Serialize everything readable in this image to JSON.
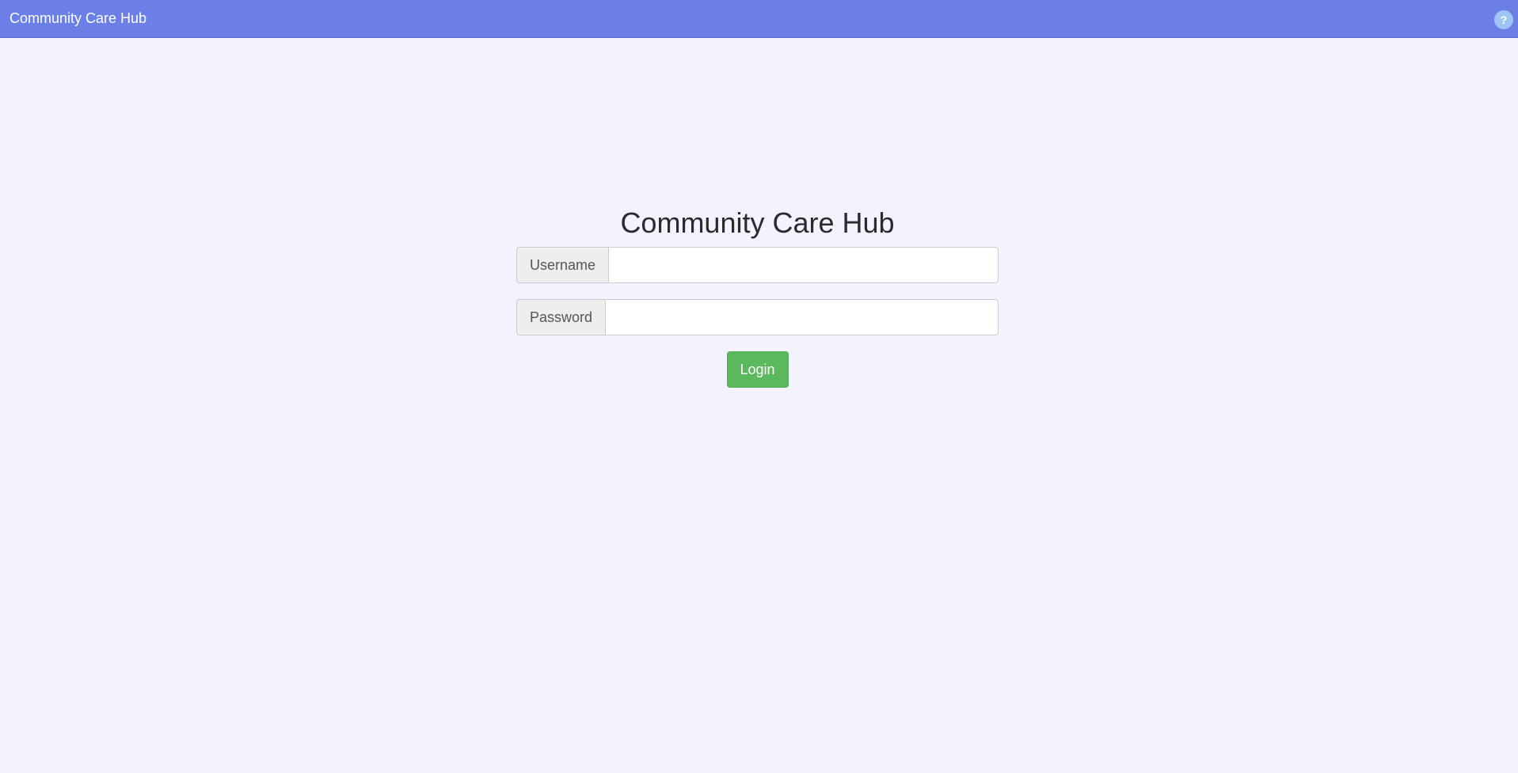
{
  "header": {
    "brand": "Community Care Hub",
    "help_icon": "?"
  },
  "login": {
    "title": "Community Care Hub",
    "username_label": "Username",
    "username_value": "",
    "password_label": "Password",
    "password_value": "",
    "submit_label": "Login"
  },
  "colors": {
    "header_bg": "#6c7fe6",
    "page_bg": "#f3f2fe",
    "button_bg": "#5cb85c"
  }
}
